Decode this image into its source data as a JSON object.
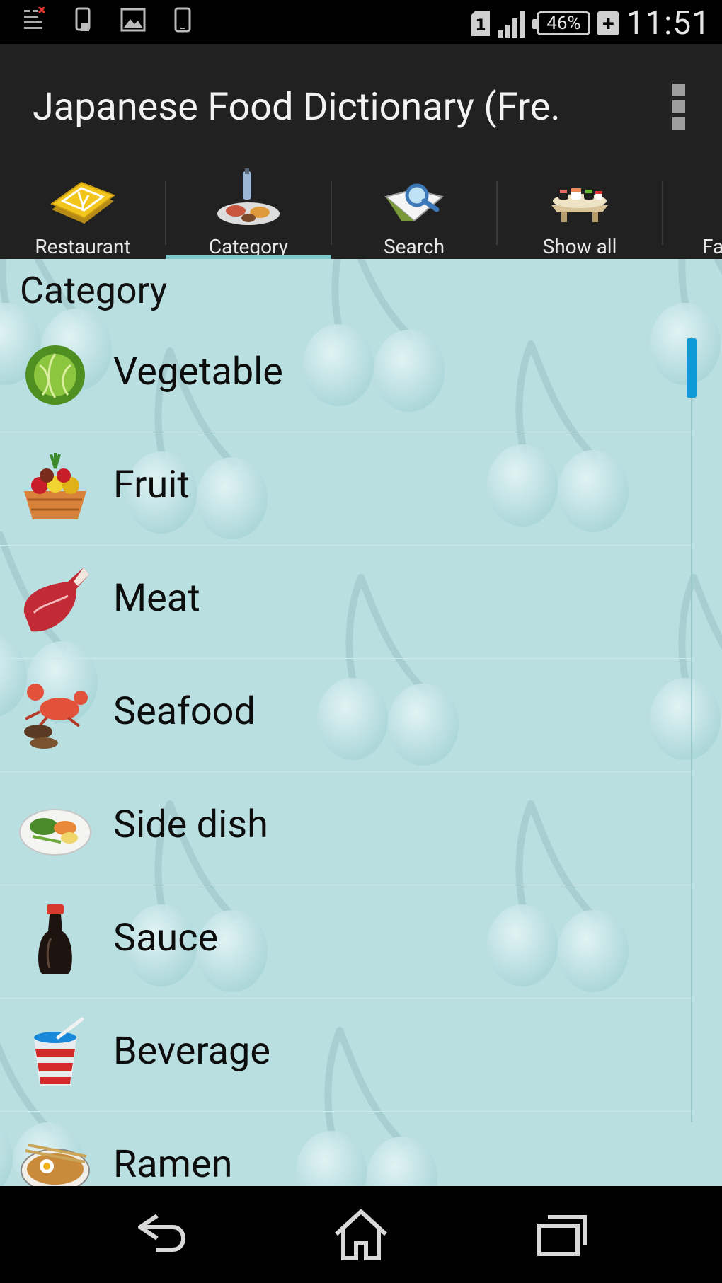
{
  "status_bar": {
    "time": "11:51",
    "battery_percent": "46%",
    "sim_slot": "1",
    "icons": [
      "notification-icon",
      "phone-icon",
      "image-icon",
      "tablet-icon",
      "sim-icon",
      "signal-icon",
      "battery-icon",
      "charging-plus-icon"
    ]
  },
  "action_bar": {
    "title": "Japanese Food Dictionary (Fre.",
    "overflow_icon": "overflow-menu-icon"
  },
  "tabs": [
    {
      "label": "Restaurant",
      "icon": "restaurant-book-icon",
      "selected": false
    },
    {
      "label": "Category",
      "icon": "category-food-icon",
      "selected": true
    },
    {
      "label": "Search",
      "icon": "search-book-icon",
      "selected": false
    },
    {
      "label": "Show all",
      "icon": "sushi-platter-icon",
      "selected": false
    },
    {
      "label": "Fa",
      "icon": "favorite-icon",
      "selected": false
    }
  ],
  "content": {
    "heading": "Category",
    "categories": [
      {
        "label": "Vegetable",
        "icon": "cabbage-icon"
      },
      {
        "label": "Fruit",
        "icon": "fruit-basket-icon"
      },
      {
        "label": "Meat",
        "icon": "steak-icon"
      },
      {
        "label": "Seafood",
        "icon": "lobster-icon"
      },
      {
        "label": "Side dish",
        "icon": "side-dish-plate-icon"
      },
      {
        "label": "Sauce",
        "icon": "soy-sauce-icon"
      },
      {
        "label": "Beverage",
        "icon": "drink-cup-icon"
      },
      {
        "label": "Ramen",
        "icon": "ramen-bowl-icon"
      }
    ]
  },
  "nav_bar": {
    "buttons": [
      "back-icon",
      "home-icon",
      "recent-apps-icon"
    ]
  },
  "colors": {
    "list_background": "#b9dfe1",
    "bar_background": "#212121",
    "tab_indicator": "#7fc7c9",
    "scroll_thumb": "#0e9ad7"
  }
}
